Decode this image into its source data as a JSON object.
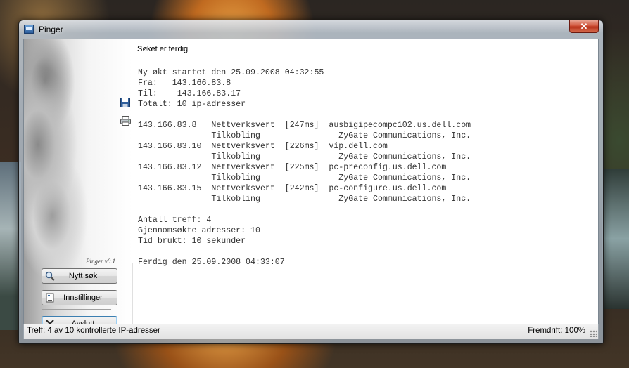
{
  "window": {
    "title": "Pinger",
    "close_glyph": "✕"
  },
  "sidebar": {
    "version": "Pinger v0.1",
    "buttons": {
      "search": "Nytt søk",
      "settings": "Innstillinger",
      "exit": "Avslutt"
    },
    "icons": [
      "magnifier-icon",
      "settings-icon",
      "close-x-icon",
      "save-icon",
      "printer-icon"
    ]
  },
  "main": {
    "status_heading": "Søket er ferdig",
    "session": {
      "started": "Ny økt startet den 25.09.2008 04:32:55",
      "from_label": "Fra:",
      "from": "143.166.83.8",
      "to_label": "Til:",
      "to": "143.166.83.17",
      "total": "Totalt: 10 ip-adresser"
    },
    "results": [
      {
        "ip": "143.166.83.8",
        "type1": "Nettverksvert",
        "time": "[247ms]",
        "host": "ausbigipecompc102.us.dell.com",
        "type2": "Tilkobling",
        "org": "ZyGate Communications, Inc."
      },
      {
        "ip": "143.166.83.10",
        "type1": "Nettverksvert",
        "time": "[226ms]",
        "host": "vip.dell.com",
        "type2": "Tilkobling",
        "org": "ZyGate Communications, Inc."
      },
      {
        "ip": "143.166.83.12",
        "type1": "Nettverksvert",
        "time": "[225ms]",
        "host": "pc-preconfig.us.dell.com",
        "type2": "Tilkobling",
        "org": "ZyGate Communications, Inc."
      },
      {
        "ip": "143.166.83.15",
        "type1": "Nettverksvert",
        "time": "[242ms]",
        "host": "pc-configure.us.dell.com",
        "type2": "Tilkobling",
        "org": "ZyGate Communications, Inc."
      }
    ],
    "summary": {
      "hits": "Antall treff: 4",
      "searched": "Gjennomsøkte adresser: 10",
      "time_used": "Tid brukt: 10 sekunder"
    },
    "finished": "Ferdig den 25.09.2008 04:33:07"
  },
  "statusbar": {
    "left": "Treff: 4 av 10 kontrollerte IP-adresser",
    "right": "Fremdrift: 100%",
    "progress": 1.0
  }
}
